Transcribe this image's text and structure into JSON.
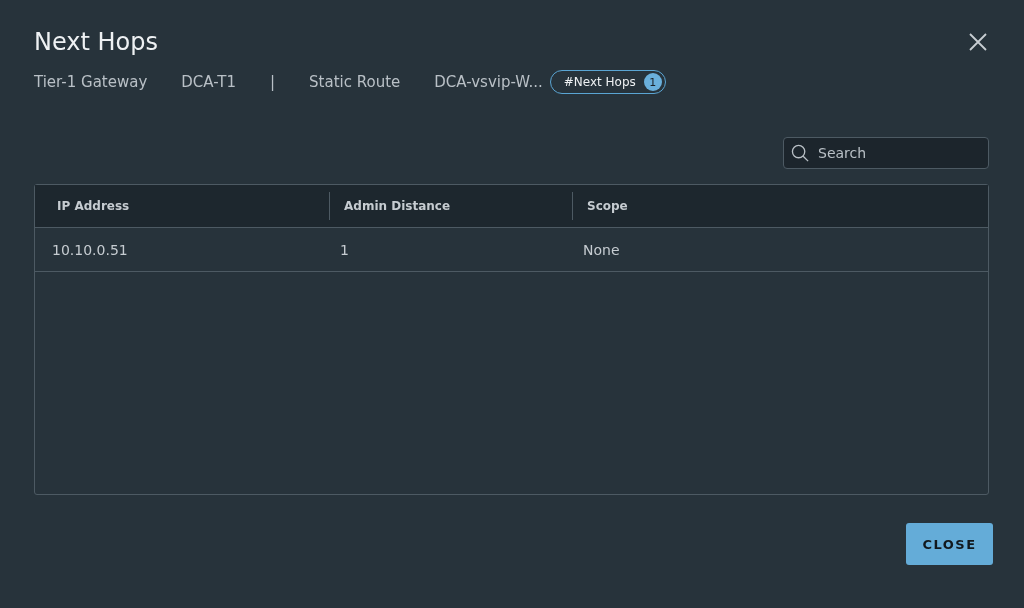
{
  "dialog": {
    "title": "Next Hops"
  },
  "breadcrumb": [
    {
      "kind": "text",
      "label": "Tier-1 Gateway"
    },
    {
      "kind": "text",
      "label": "DCA-T1"
    },
    {
      "kind": "separator",
      "label": "|"
    },
    {
      "kind": "text",
      "label": "Static Route"
    },
    {
      "kind": "text",
      "label": "DCA-vsvip-W..."
    },
    {
      "kind": "pill",
      "label": "#Next Hops",
      "count": "1"
    }
  ],
  "search": {
    "placeholder": "Search"
  },
  "table": {
    "columns": [
      "IP Address",
      "Admin Distance",
      "Scope"
    ],
    "rows": [
      [
        "10.10.0.51",
        "1",
        "None"
      ]
    ]
  },
  "buttons": [
    "CLOSE"
  ]
}
